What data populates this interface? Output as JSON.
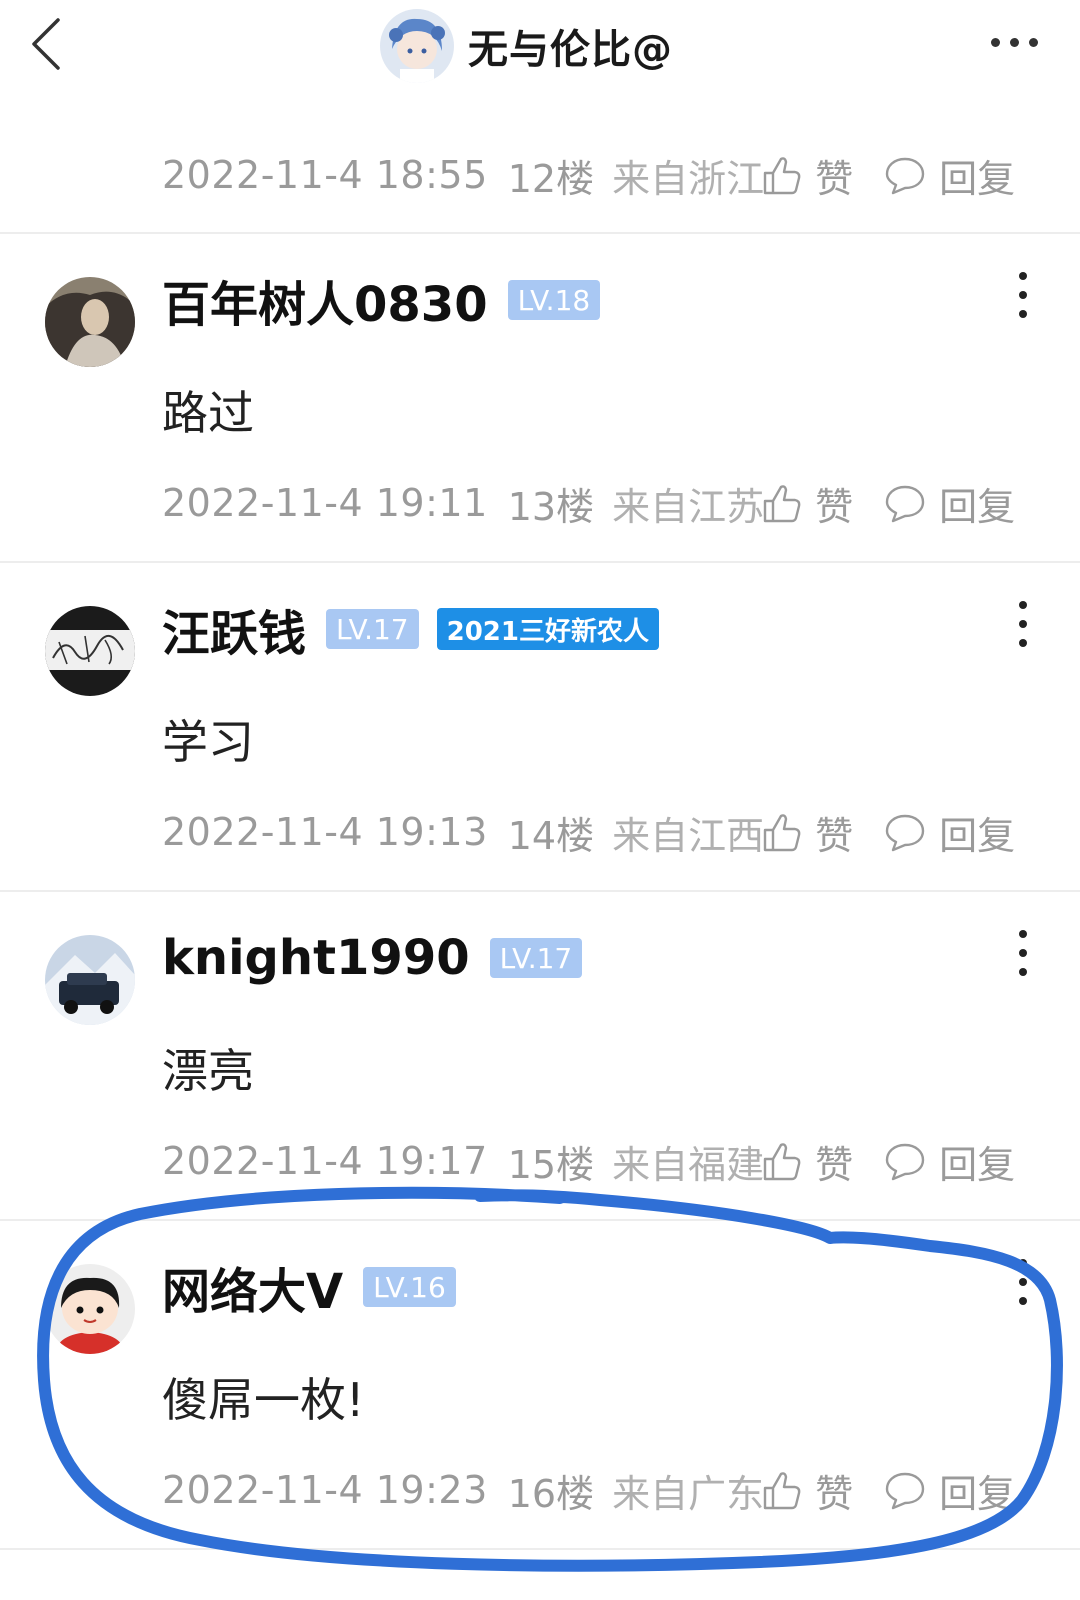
{
  "header": {
    "title": "无与伦比@",
    "back_icon": "chevron-left-icon",
    "more_icon": "more-horizontal-icon"
  },
  "top_meta": {
    "time": "2022-11-4 18:55",
    "floor": "12楼",
    "location": "来自浙江",
    "like_label": "赞",
    "reply_label": "回复"
  },
  "posts": [
    {
      "username": "百年树人0830",
      "level": "LV.18",
      "badge": "",
      "content": "路过",
      "time": "2022-11-4 19:11",
      "floor": "13楼",
      "location": "来自江苏",
      "like_label": "赞",
      "reply_label": "回复"
    },
    {
      "username": "汪跃钱",
      "level": "LV.17",
      "badge": "2021三好新农人",
      "content": "学习",
      "time": "2022-11-4 19:13",
      "floor": "14楼",
      "location": "来自江西",
      "like_label": "赞",
      "reply_label": "回复"
    },
    {
      "username": "knight1990",
      "level": "LV.17",
      "badge": "",
      "content": "漂亮",
      "time": "2022-11-4 19:17",
      "floor": "15楼",
      "location": "来自福建",
      "like_label": "赞",
      "reply_label": "回复"
    },
    {
      "username": "网络大V",
      "level": "LV.16",
      "badge": "",
      "content": "傻屌一枚!",
      "time": "2022-11-4 19:23",
      "floor": "16楼",
      "location": "来自广东",
      "like_label": "赞",
      "reply_label": "回复"
    }
  ],
  "colors": {
    "level_badge": "#a9c8f3",
    "special_badge": "#1e8fe6",
    "meta_text": "#9a9a9a",
    "annotation_stroke": "#2f6fd6"
  }
}
